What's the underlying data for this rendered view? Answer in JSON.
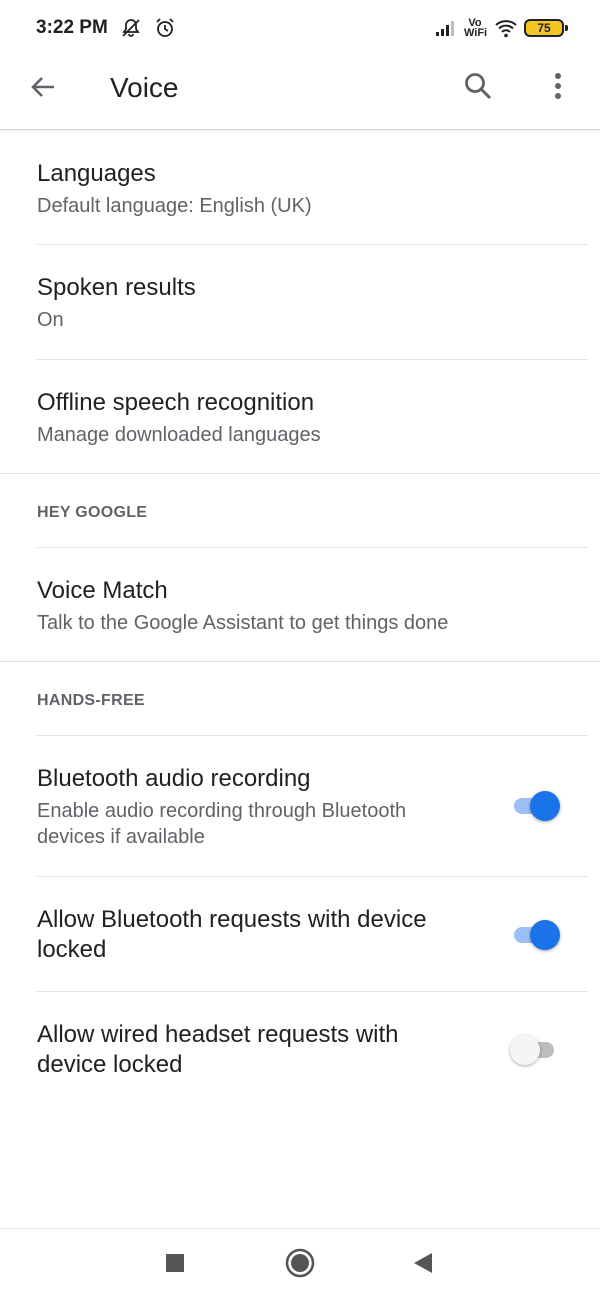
{
  "status_bar": {
    "time": "3:22 PM",
    "vowifi_top": "Vo",
    "vowifi_bottom": "WiFi",
    "battery": "75",
    "icons": [
      "bell-off-icon",
      "alarm-icon",
      "signal-icon",
      "wifi-icon",
      "battery-icon"
    ]
  },
  "app_bar": {
    "title": "Voice",
    "icons": [
      "back-arrow-icon",
      "search-icon",
      "more-vert-icon"
    ]
  },
  "settings": {
    "languages": {
      "title": "Languages",
      "subtitle": "Default language: English (UK)"
    },
    "spoken_results": {
      "title": "Spoken results",
      "subtitle": "On"
    },
    "offline_speech": {
      "title": "Offline speech recognition",
      "subtitle": "Manage downloaded languages"
    },
    "hey_google_header": "HEY GOOGLE",
    "voice_match": {
      "title": "Voice Match",
      "subtitle": "Talk to the Google Assistant to get things done"
    },
    "hands_free_header": "HANDS-FREE",
    "bluetooth_audio": {
      "title": "Bluetooth audio recording",
      "subtitle_line1": "Enable audio recording through Bluetooth",
      "subtitle_line2": "devices if available",
      "enabled": true
    },
    "bluetooth_locked": {
      "title_line1": "Allow Bluetooth requests with device",
      "title_line2": "locked",
      "enabled": true
    },
    "wired_locked": {
      "title_line1": "Allow wired headset requests with",
      "title_line2": "device locked",
      "enabled": false
    }
  },
  "nav_bar": {
    "icons": [
      "recents-square-icon",
      "home-circle-icon",
      "back-triangle-icon"
    ]
  },
  "colors": {
    "accent": "#1a73e8",
    "accent_track": "#9cbff5",
    "battery_fill": "#f3c623",
    "text_primary": "#202124",
    "text_secondary": "#5f6368"
  }
}
